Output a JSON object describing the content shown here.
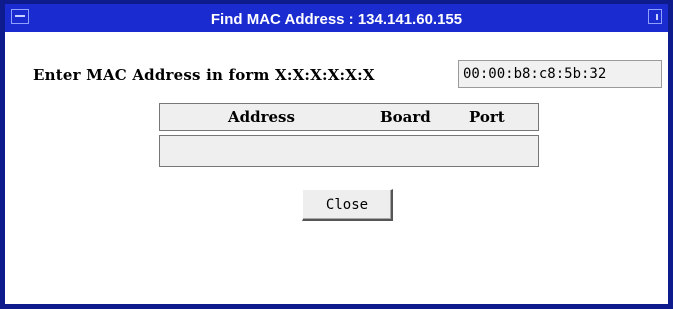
{
  "window": {
    "title": "Find MAC Address : 134.141.60.155"
  },
  "form": {
    "mac_label": "Enter MAC Address in form X:X:X:X:X:X",
    "mac_value": "00:00:b8:c8:5b:32"
  },
  "results": {
    "columns": [
      "Address",
      "Board",
      "Port"
    ],
    "rows": []
  },
  "buttons": {
    "close_label": "Close"
  },
  "colors": {
    "titlebar": "#1a2bd0",
    "frame": "#0e1b8c",
    "panel": "#efefef"
  },
  "icons": [
    "window-menu-icon",
    "maximize-icon"
  ]
}
